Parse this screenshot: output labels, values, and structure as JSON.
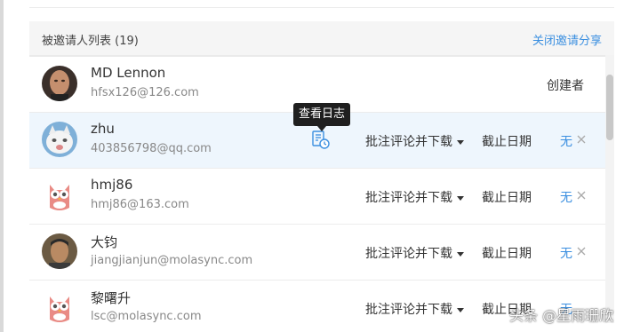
{
  "header": {
    "title": "被邀请人列表 (19)",
    "close_share": "关闭邀请分享"
  },
  "tooltip": "查看日志",
  "colors": {
    "link": "#3b8fe0",
    "highlight_row": "#eef6fd"
  },
  "invitees": [
    {
      "name": "MD Lennon",
      "email": "hfsx126@126.com",
      "role": "创建者",
      "avatar": "photo-man-avatar"
    },
    {
      "name": "zhu",
      "email": "403856798@qq.com",
      "permission": "批注评论并下载",
      "deadline_label": "截止日期",
      "deadline_value": "无",
      "avatar": "cat-avatar"
    },
    {
      "name": "hmj86",
      "email": "hmj86@163.com",
      "permission": "批注评论并下载",
      "deadline_label": "截止日期",
      "deadline_value": "无",
      "avatar": "owl-avatar"
    },
    {
      "name": "大钧",
      "email": "jiangjianjun@molasync.com",
      "permission": "批注评论并下载",
      "deadline_label": "截止日期",
      "deadline_value": "无",
      "avatar": "photo-person-avatar"
    },
    {
      "name": "黎曙升",
      "email": "lsc@molasync.com",
      "permission": "批注评论并下载",
      "deadline_label": "截止日期",
      "deadline_value": "无",
      "avatar": "owl-avatar"
    }
  ],
  "watermark": "头条 @星雨珊欣"
}
